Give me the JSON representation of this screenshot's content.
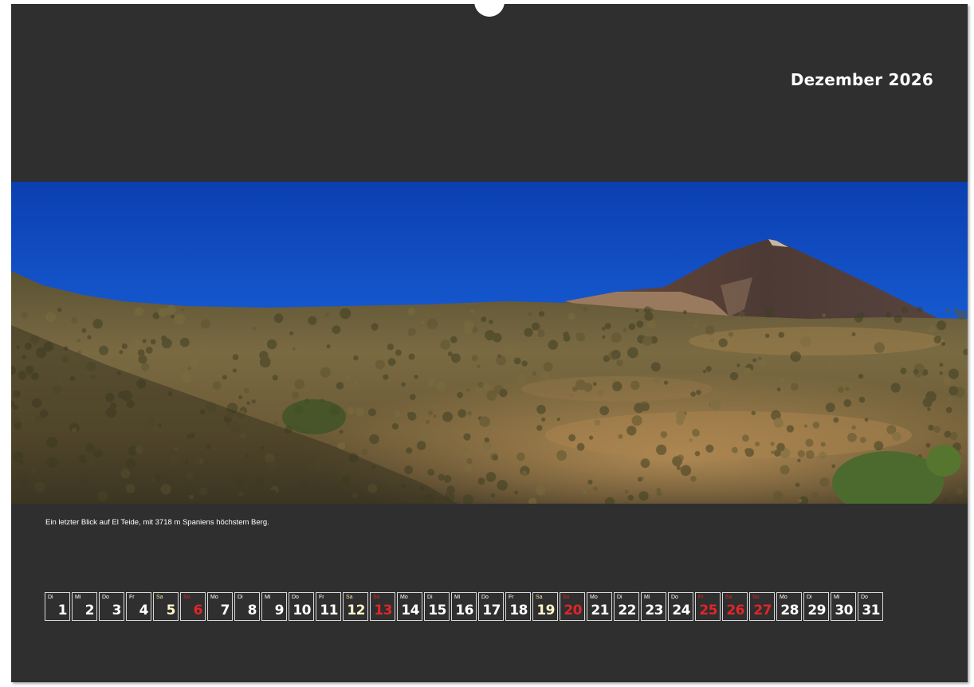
{
  "calendar": {
    "month_title": "Dezember 2026",
    "caption": "Ein letzter Blick auf El Teide, mit 3718 m Spaniens höchstem Berg.",
    "colors": {
      "background": "#2f2f2f",
      "text": "#ffffff",
      "weekend_saturday": "#fff5c8",
      "sunday_holiday": "#e0262a"
    },
    "days": [
      {
        "dow": "Di",
        "num": "1",
        "type": "normal"
      },
      {
        "dow": "Mi",
        "num": "2",
        "type": "normal"
      },
      {
        "dow": "Do",
        "num": "3",
        "type": "normal"
      },
      {
        "dow": "Fr",
        "num": "4",
        "type": "normal"
      },
      {
        "dow": "Sa",
        "num": "5",
        "type": "sat"
      },
      {
        "dow": "So",
        "num": "6",
        "type": "red"
      },
      {
        "dow": "Mo",
        "num": "7",
        "type": "normal"
      },
      {
        "dow": "Di",
        "num": "8",
        "type": "normal"
      },
      {
        "dow": "Mi",
        "num": "9",
        "type": "normal"
      },
      {
        "dow": "Do",
        "num": "10",
        "type": "normal"
      },
      {
        "dow": "Fr",
        "num": "11",
        "type": "normal"
      },
      {
        "dow": "Sa",
        "num": "12",
        "type": "sat"
      },
      {
        "dow": "So",
        "num": "13",
        "type": "red"
      },
      {
        "dow": "Mo",
        "num": "14",
        "type": "normal"
      },
      {
        "dow": "Di",
        "num": "15",
        "type": "normal"
      },
      {
        "dow": "Mi",
        "num": "16",
        "type": "normal"
      },
      {
        "dow": "Do",
        "num": "17",
        "type": "normal"
      },
      {
        "dow": "Fr",
        "num": "18",
        "type": "normal"
      },
      {
        "dow": "Sa",
        "num": "19",
        "type": "sat"
      },
      {
        "dow": "So",
        "num": "20",
        "type": "red"
      },
      {
        "dow": "Mo",
        "num": "21",
        "type": "normal"
      },
      {
        "dow": "Di",
        "num": "22",
        "type": "normal"
      },
      {
        "dow": "Mi",
        "num": "23",
        "type": "normal"
      },
      {
        "dow": "Do",
        "num": "24",
        "type": "normal"
      },
      {
        "dow": "Fr",
        "num": "25",
        "type": "red"
      },
      {
        "dow": "Sa",
        "num": "26",
        "type": "red"
      },
      {
        "dow": "So",
        "num": "27",
        "type": "red"
      },
      {
        "dow": "Mo",
        "num": "28",
        "type": "normal"
      },
      {
        "dow": "Di",
        "num": "29",
        "type": "normal"
      },
      {
        "dow": "Mi",
        "num": "30",
        "type": "normal"
      },
      {
        "dow": "Do",
        "num": "31",
        "type": "normal"
      }
    ]
  }
}
